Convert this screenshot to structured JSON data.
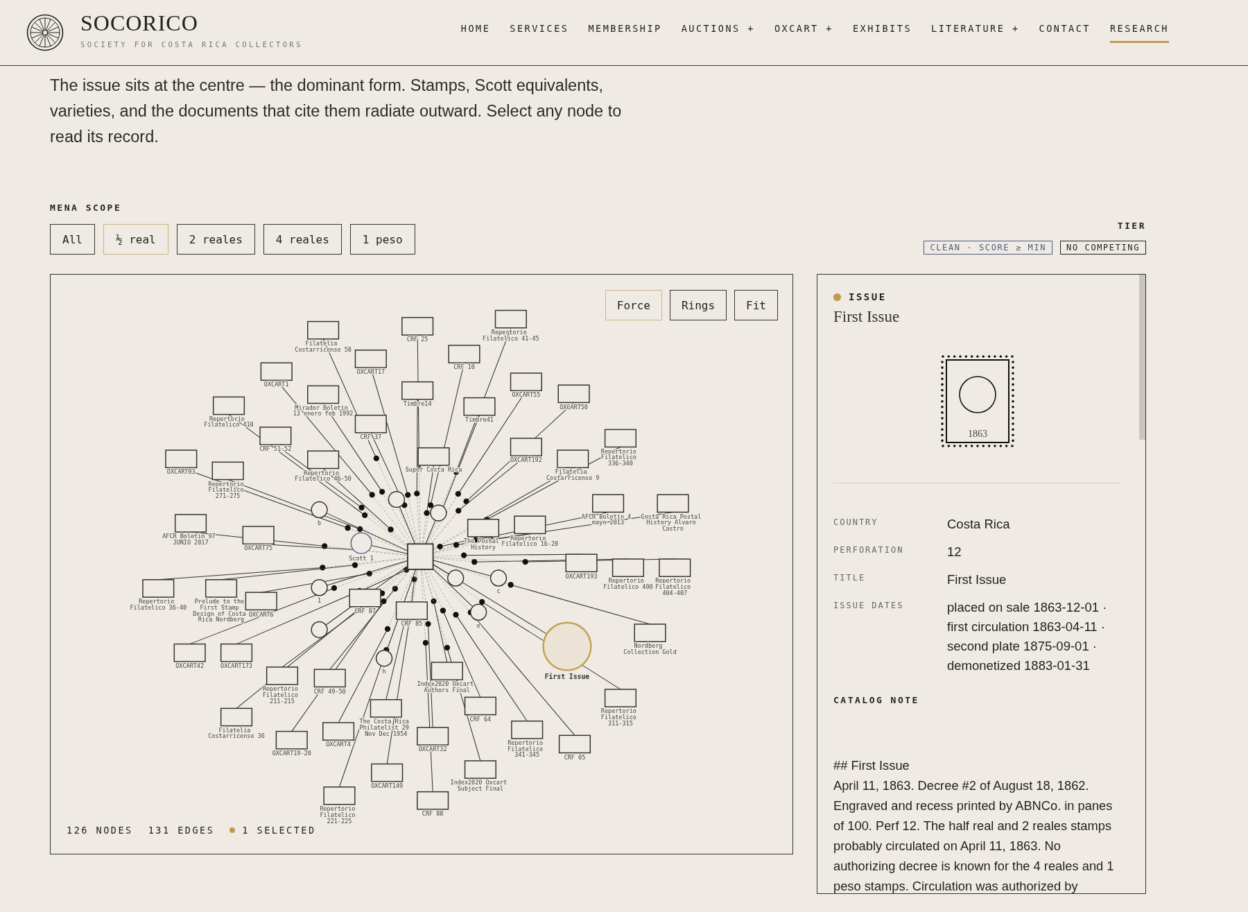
{
  "brand": {
    "name": "SOCORICO",
    "tagline": "SOCIETY FOR COSTA RICA COLLECTORS"
  },
  "nav": [
    {
      "label": "HOME",
      "selected": false
    },
    {
      "label": "SERVICES",
      "selected": false
    },
    {
      "label": "MEMBERSHIP",
      "selected": false
    },
    {
      "label": "AUCTIONS",
      "menu_mark": "+",
      "selected": false
    },
    {
      "label": "OXCART",
      "menu_mark": "+",
      "selected": false
    },
    {
      "label": "EXHIBITS",
      "selected": false
    },
    {
      "label": "LITERATURE",
      "menu_mark": "+",
      "selected": false
    },
    {
      "label": "CONTACT",
      "selected": false
    },
    {
      "label": "RESEARCH",
      "selected": true
    }
  ],
  "intro": "The issue sits at the centre — the dominant form. Stamps, Scott equivalents, varieties, and the documents that cite them radiate outward. Select any node to read its record.",
  "scope": {
    "label": "MENA SCOPE",
    "options": [
      {
        "label": "All",
        "selected": false
      },
      {
        "label": "½ real",
        "selected": true
      },
      {
        "label": "2 reales",
        "selected": false
      },
      {
        "label": "4 reales",
        "selected": false
      },
      {
        "label": "1 peso",
        "selected": false
      }
    ]
  },
  "tier": {
    "label": "TIER",
    "tags": [
      {
        "label": "CLEAN · SCORE ≥ MIN",
        "color": "#4f5d78"
      },
      {
        "label": "NO COMPETING",
        "color": "#222222"
      }
    ]
  },
  "graph": {
    "layouts": [
      {
        "label": "Force",
        "selected": true
      },
      {
        "label": "Rings",
        "selected": false
      },
      {
        "label": "Fit",
        "selected": false
      }
    ],
    "documents": [
      {
        "label": "Filatelia Costarricense 58",
        "selected": false
      },
      {
        "label": "CRF 25",
        "selected": false
      },
      {
        "label": "Repertorio Filatelico 41-45",
        "selected": false
      },
      {
        "label": "OXCART1",
        "selected": false
      },
      {
        "label": "OXCART17",
        "selected": false
      },
      {
        "label": "CRF 10",
        "selected": false
      },
      {
        "label": "Mirador Boletin 13 enero feb 1992",
        "selected": false
      },
      {
        "label": "Timbre14",
        "selected": false
      },
      {
        "label": "OXCART55",
        "selected": false
      },
      {
        "label": "OXCART50",
        "selected": false
      },
      {
        "label": "Repertorio Filatelico 410",
        "selected": false
      },
      {
        "label": "Timbre41",
        "selected": false
      },
      {
        "label": "CRF 51-52",
        "selected": false
      },
      {
        "label": "CRF 37",
        "selected": false
      },
      {
        "label": "Repertorio Filatelico 336-340",
        "selected": false
      },
      {
        "label": "OXCART03",
        "selected": false
      },
      {
        "label": "Repertorio Filatelico 46-50",
        "selected": false
      },
      {
        "label": "Super Costa Rica",
        "selected": false
      },
      {
        "label": "OXCART192",
        "selected": false
      },
      {
        "label": "Filatelia Costarricense 9",
        "selected": false
      },
      {
        "label": "Repertorio Filatelico 271-275",
        "selected": false
      },
      {
        "label": "AFCR Boletin 4 mayo 2013",
        "selected": false
      },
      {
        "label": "Costa Rica Postal History Alvaro Castro",
        "selected": false
      },
      {
        "label": "AFCR Boletin 97 JUNIO 2017",
        "selected": false
      },
      {
        "label": "OXCART75",
        "selected": false
      },
      {
        "label": "The Postal History",
        "selected": false
      },
      {
        "label": "Repertorio Filatelico 16-20",
        "selected": false
      },
      {
        "label": "OXCART193",
        "selected": false
      },
      {
        "label": "Repertorio Filatelico 400",
        "selected": false
      },
      {
        "label": "Repertorio Filatelico 404-407",
        "selected": false
      },
      {
        "label": "Repertorio Filatelico 36-40",
        "selected": false
      },
      {
        "label": "Prelude to the First Stamp Design of Costa Rica Nordberg",
        "selected": false
      },
      {
        "label": "OXCART6",
        "selected": false
      },
      {
        "label": "CRF 87",
        "selected": false
      },
      {
        "label": "CRF 85",
        "selected": false
      },
      {
        "label": "Nordberg Collection Gold",
        "selected": false
      },
      {
        "label": "OXCART42",
        "selected": false
      },
      {
        "label": "OXCART173",
        "selected": false
      },
      {
        "label": "Repertorio Filatelico 211-215",
        "selected": false
      },
      {
        "label": "CRF 49-50",
        "selected": false
      },
      {
        "label": "Index2020 Oxcart Authors Final",
        "selected": false
      },
      {
        "label": "The Costa Rica Philatelist 29 Nov Dec 1954",
        "selected": false
      },
      {
        "label": "CRF 64",
        "selected": false
      },
      {
        "label": "Repertorio Filatelico 311-315",
        "selected": false
      },
      {
        "label": "Filatelia Costarricense 36",
        "selected": false
      },
      {
        "label": "OXCART19-20",
        "selected": false
      },
      {
        "label": "OXCART4",
        "selected": false
      },
      {
        "label": "OXCART32",
        "selected": false
      },
      {
        "label": "Repertorio Filatelico 341-345",
        "selected": false
      },
      {
        "label": "CRF 05",
        "selected": false
      },
      {
        "label": "OXCART149",
        "selected": false
      },
      {
        "label": "Index2020 Oxcart Subject Final",
        "selected": false
      },
      {
        "label": "Repertorio Filatelico 221-225",
        "selected": false
      },
      {
        "label": "CRF 88",
        "selected": false
      }
    ],
    "nodes": [
      {
        "kind": "stamp",
        "label": "b",
        "selected": false
      },
      {
        "kind": "stamp",
        "selected": false
      },
      {
        "kind": "stamp",
        "selected": false
      },
      {
        "kind": "scott",
        "label": "Scott 1",
        "selected": false
      },
      {
        "kind": "hub",
        "selected": false
      },
      {
        "kind": "stamp",
        "label": "1",
        "selected": false
      },
      {
        "kind": "stamp",
        "selected": false
      },
      {
        "kind": "stamp",
        "label": "c",
        "selected": false
      },
      {
        "kind": "stamp",
        "selected": false
      },
      {
        "kind": "stamp",
        "label": "e",
        "selected": false
      },
      {
        "kind": "stamp",
        "label": "h",
        "selected": false
      },
      {
        "kind": "issue",
        "label": "First Issue",
        "selected": true
      }
    ],
    "stats": [
      "126 NODES",
      "131 EDGES"
    ],
    "selected_count": "1 SELECTED"
  },
  "detail": {
    "kind_label": "ISSUE",
    "title": "First Issue",
    "stamp_year": "1863",
    "fields": [
      {
        "label": "COUNTRY",
        "lines": [
          "Costa Rica"
        ]
      },
      {
        "label": "PERFORATION",
        "lines": [
          "12"
        ]
      },
      {
        "label": "TITLE",
        "lines": [
          "First Issue"
        ]
      },
      {
        "label": "ISSUE DATES",
        "lines": [
          "placed on sale 1863-12-01 ·",
          "first circulation 1863-04-11 ·",
          "second plate 1875-09-01 ·",
          "demonetized 1883-01-31"
        ]
      }
    ],
    "note_label": "CATALOG NOTE",
    "note_heading": "## First Issue",
    "note": "April 11, 1863. Decree #2 of August 18, 1862. Engraved and recess printed by ABNCo. in panes of 100. Perf 12. The half real and 2 reales stamps probably circulated on April 11, 1863. No authorizing decree is known for the 4 reales and 1 peso stamps. Circulation was authorized by"
  }
}
